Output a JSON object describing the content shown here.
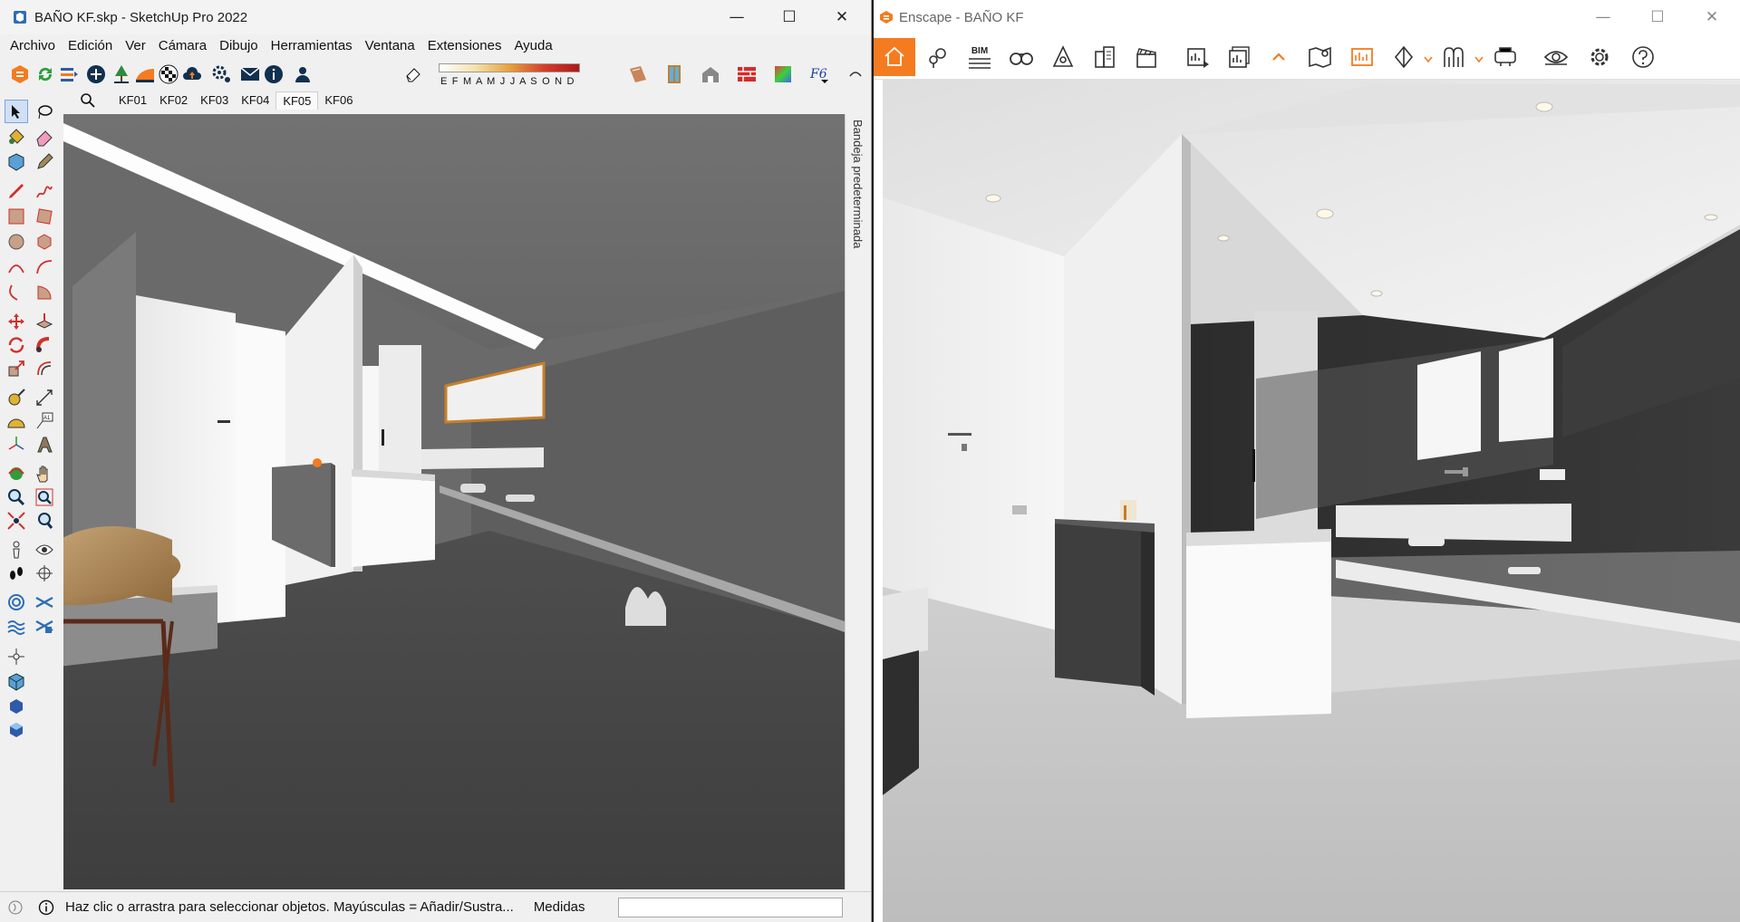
{
  "sketchup": {
    "title": "BAÑO KF.skp - SketchUp Pro 2022",
    "menu": [
      "Archivo",
      "Edición",
      "Ver",
      "Cámara",
      "Dibujo",
      "Herramientas",
      "Ventana",
      "Extensiones",
      "Ayuda"
    ],
    "months_strip": "E F M A M J J A S O N D",
    "scene_tabs": [
      "KF01",
      "KF02",
      "KF03",
      "KF04",
      "KF05",
      "KF06"
    ],
    "active_tab": "KF05",
    "tray_label": "Bandeja predeterminada",
    "status_message": "Haz clic o arrastra para seleccionar objetos. Mayúsculas = Añadir/Sustra...",
    "measurements_label": "Medidas",
    "measurements_value": ""
  },
  "enscape": {
    "title": "Enscape - BAÑO KF",
    "bim_label": "BIM",
    "accent": "#f47b20"
  },
  "window_controls": {
    "minimize": "—",
    "maximize": "☐",
    "close": "✕"
  }
}
